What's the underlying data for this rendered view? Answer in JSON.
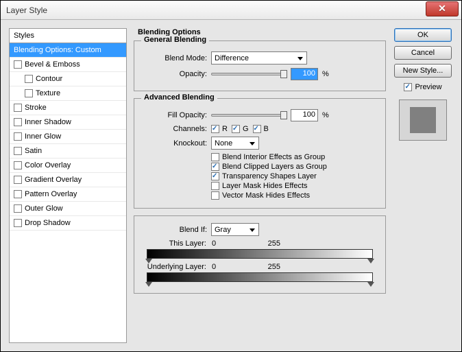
{
  "window": {
    "title": "Layer Style"
  },
  "left": {
    "header": "Styles",
    "items": [
      {
        "label": "Blending Options: Custom",
        "selected": true,
        "checkbox": false,
        "indent": false
      },
      {
        "label": "Bevel & Emboss",
        "selected": false,
        "checkbox": true,
        "indent": false
      },
      {
        "label": "Contour",
        "selected": false,
        "checkbox": true,
        "indent": true
      },
      {
        "label": "Texture",
        "selected": false,
        "checkbox": true,
        "indent": true
      },
      {
        "label": "Stroke",
        "selected": false,
        "checkbox": true,
        "indent": false
      },
      {
        "label": "Inner Shadow",
        "selected": false,
        "checkbox": true,
        "indent": false
      },
      {
        "label": "Inner Glow",
        "selected": false,
        "checkbox": true,
        "indent": false
      },
      {
        "label": "Satin",
        "selected": false,
        "checkbox": true,
        "indent": false
      },
      {
        "label": "Color Overlay",
        "selected": false,
        "checkbox": true,
        "indent": false
      },
      {
        "label": "Gradient Overlay",
        "selected": false,
        "checkbox": true,
        "indent": false
      },
      {
        "label": "Pattern Overlay",
        "selected": false,
        "checkbox": true,
        "indent": false
      },
      {
        "label": "Outer Glow",
        "selected": false,
        "checkbox": true,
        "indent": false
      },
      {
        "label": "Drop Shadow",
        "selected": false,
        "checkbox": true,
        "indent": false
      }
    ]
  },
  "mid": {
    "title": "Blending Options",
    "general": {
      "legend": "General Blending",
      "blend_mode_label": "Blend Mode:",
      "blend_mode_value": "Difference",
      "opacity_label": "Opacity:",
      "opacity_value": "100",
      "pct": "%"
    },
    "advanced": {
      "legend": "Advanced Blending",
      "fill_opacity_label": "Fill Opacity:",
      "fill_opacity_value": "100",
      "pct": "%",
      "channels_label": "Channels:",
      "ch_r": "R",
      "ch_g": "G",
      "ch_b": "B",
      "knockout_label": "Knockout:",
      "knockout_value": "None",
      "opts": {
        "interior": "Blend Interior Effects as Group",
        "clipped": "Blend Clipped Layers as Group",
        "transparency": "Transparency Shapes Layer",
        "layermask": "Layer Mask Hides Effects",
        "vectormask": "Vector Mask Hides Effects"
      }
    },
    "blendif": {
      "label": "Blend If:",
      "value": "Gray",
      "this_label": "This Layer:",
      "this_lo": "0",
      "this_hi": "255",
      "under_label": "Underlying Layer:",
      "under_lo": "0",
      "under_hi": "255"
    }
  },
  "right": {
    "ok": "OK",
    "cancel": "Cancel",
    "new_style": "New Style...",
    "preview": "Preview"
  }
}
